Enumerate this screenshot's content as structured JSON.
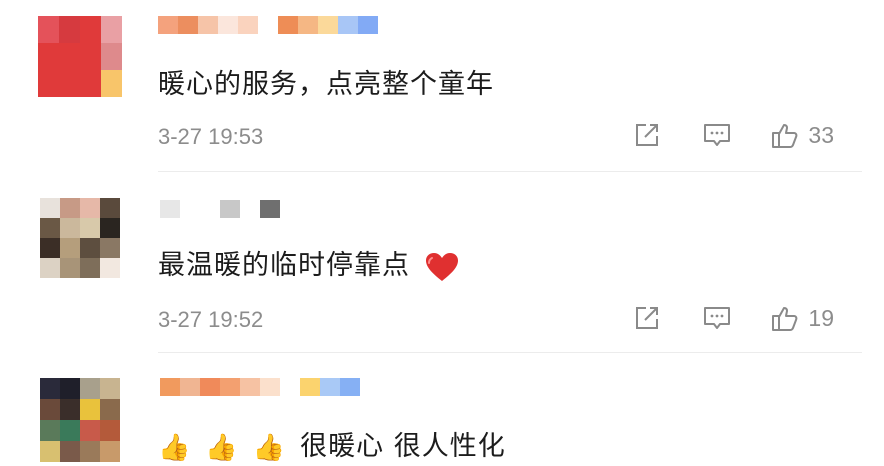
{
  "comments": [
    {
      "text": "暖心的服务，点亮整个童年",
      "time": "3-27 19:53",
      "likes": "33",
      "avatar_colors": [
        "#e4525a",
        "#d63a3f",
        "#e03a3a",
        "#e9a0a4",
        "#e03a3a",
        "#e03a3a",
        "#e03a3a",
        "#de8a8c",
        "#e03a3a",
        "#e03a3a",
        "#e03a3a",
        "#f8c56a"
      ],
      "name_colors": [
        "#f4a27d",
        "#ec8e5f",
        "#f6c4a8",
        "#fbe6dc",
        "#fad3be",
        "#ffffff",
        "#ee8d56",
        "#f5b784",
        "#fbd99a",
        "#a8c6f6",
        "#82aaf5"
      ]
    },
    {
      "text": "最温暖的临时停靠点",
      "time": "3-27 19:52",
      "likes": "19",
      "avatar_colors": [
        "#e8e2dc",
        "#c79a86",
        "#e6b8a8",
        "#5a4a3c",
        "#6a5845",
        "#cbb89c",
        "#d8c9aa",
        "#2a2520",
        "#3b2e26",
        "#b59e7c",
        "#5d4e3f",
        "#8a7864",
        "#dcd2c4",
        "#a89478",
        "#7e6e5a",
        "#f2e8e0"
      ],
      "name_colors": [
        "#e7e7e7",
        "#ffffff",
        "#ffffff",
        "#c8c8c8",
        "#ffffff",
        "#6f6f6f"
      ]
    },
    {
      "text": "很暖心 很人性化",
      "avatar_colors": [
        "#2a2a3a",
        "#1f1f2a",
        "#a8a08c",
        "#c8b490",
        "#6a4a3a",
        "#3a2e2a",
        "#e9c23c",
        "#8a6a4c",
        "#5a7a5a",
        "#3a7a5a",
        "#c85a4a",
        "#b45a3a",
        "#d8c070",
        "#7a5a4a",
        "#9a7a5a",
        "#c89a6a"
      ],
      "name_colors": [
        "#f19a5e",
        "#f0b592",
        "#f08a5a",
        "#f3a070",
        "#f6c2a3",
        "#fbe0cc",
        "#ffffff",
        "#fbd36e",
        "#a9c9f6",
        "#86b0f4"
      ],
      "thumbs": [
        "👍",
        "👍",
        "👍"
      ]
    }
  ],
  "icons": {
    "share": "share-icon",
    "reply": "comment-icon",
    "like": "thumbs-up-icon",
    "heart": "heart-icon"
  },
  "colors": {
    "text": "#1c1c1c",
    "meta": "#8c8c8c",
    "divider": "#ececec",
    "heart": "#e03030"
  }
}
